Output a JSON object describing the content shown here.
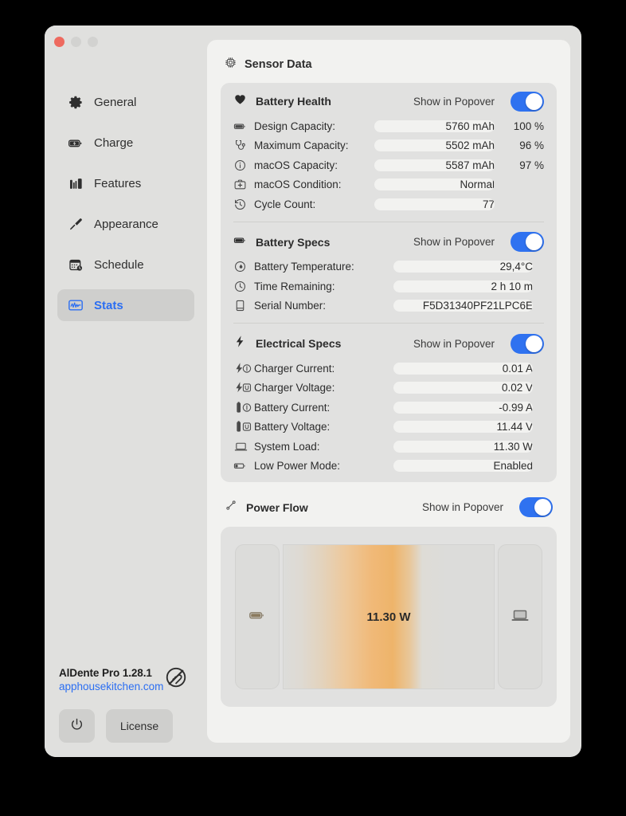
{
  "window": {
    "traffic_lights": [
      "close",
      "minimize",
      "zoom"
    ]
  },
  "sidebar": {
    "items": [
      {
        "label": "General",
        "icon": "gear-icon",
        "active": false
      },
      {
        "label": "Charge",
        "icon": "battery-bolt-icon",
        "active": false
      },
      {
        "label": "Features",
        "icon": "bar-chart-icon",
        "active": false
      },
      {
        "label": "Appearance",
        "icon": "paintbrush-icon",
        "active": false
      },
      {
        "label": "Schedule",
        "icon": "calendar-clock-icon",
        "active": false
      },
      {
        "label": "Stats",
        "icon": "waveform-icon",
        "active": true
      }
    ],
    "footer": {
      "product": "AlDente Pro 1.28.1",
      "link": "apphousekitchen.com",
      "pasta_icon": "pasta-no-icon",
      "power_button": "power-icon",
      "license_label": "License"
    }
  },
  "main": {
    "page_title": "Sensor Data",
    "page_icon": "cpu-chip-icon",
    "sections": [
      {
        "title": "Battery Health",
        "icon": "heart-icon",
        "toggle_label": "Show in Popover",
        "toggle_on": true,
        "rows": [
          {
            "icon": "battery-full-icon",
            "label": "Design Capacity:",
            "value": "5760 mAh",
            "pct": "100 %"
          },
          {
            "icon": "stethoscope-icon",
            "label": "Maximum Capacity:",
            "value": "5502 mAh",
            "pct": "96 %"
          },
          {
            "icon": "info-circle-icon",
            "label": "macOS Capacity:",
            "value": "5587 mAh",
            "pct": "97 %"
          },
          {
            "icon": "medkit-icon",
            "label": "macOS Condition:",
            "value": "Normal",
            "pct": ""
          },
          {
            "icon": "clock-arrow-icon",
            "label": "Cycle Count:",
            "value": "77",
            "pct": ""
          }
        ]
      },
      {
        "title": "Battery Specs",
        "icon": "battery-full-icon",
        "toggle_label": "Show in Popover",
        "toggle_on": true,
        "rows": [
          {
            "icon": "thermometer-drop-icon",
            "label": "Battery Temperature:",
            "value": "29,4°C",
            "pct": ""
          },
          {
            "icon": "clock-icon",
            "label": "Time Remaining:",
            "value": "2 h 10 m",
            "pct": ""
          },
          {
            "icon": "serial-card-icon",
            "label": "Serial Number:",
            "value": "F5D31340PF21LPC6E",
            "pct": ""
          }
        ]
      },
      {
        "title": "Electrical Specs",
        "icon": "bolt-icon",
        "toggle_label": "Show in Popover",
        "toggle_on": true,
        "rows": [
          {
            "icon": "bolt-current-icon",
            "label": "Charger Current:",
            "value": "0.01 A",
            "pct": ""
          },
          {
            "icon": "bolt-voltage-icon",
            "label": "Charger Voltage:",
            "value": "0.02 V",
            "pct": ""
          },
          {
            "icon": "battery-current-icon",
            "label": "Battery Current:",
            "value": "-0.99 A",
            "pct": ""
          },
          {
            "icon": "battery-voltage-icon",
            "label": "Battery Voltage:",
            "value": "11.44 V",
            "pct": ""
          },
          {
            "icon": "laptop-icon",
            "label": "System Load:",
            "value": "11.30 W",
            "pct": ""
          },
          {
            "icon": "battery-low-icon",
            "label": "Low Power Mode:",
            "value": "Enabled",
            "pct": ""
          }
        ]
      }
    ],
    "power_flow": {
      "title": "Power Flow",
      "icon": "cable-icon",
      "toggle_label": "Show in Popover",
      "toggle_on": true,
      "source_icon": "battery-icon",
      "target_icon": "laptop-icon",
      "watts": "11.30 W"
    }
  },
  "colors": {
    "accent": "#2b6ef2",
    "toggle_on": "#2f72f0",
    "window_bg": "#e0e0de",
    "panel_bg": "#f2f2f0",
    "card_bg": "#e1e1e0",
    "flow_peak": "#eeb46a",
    "close_button": "#ee6a5f"
  }
}
